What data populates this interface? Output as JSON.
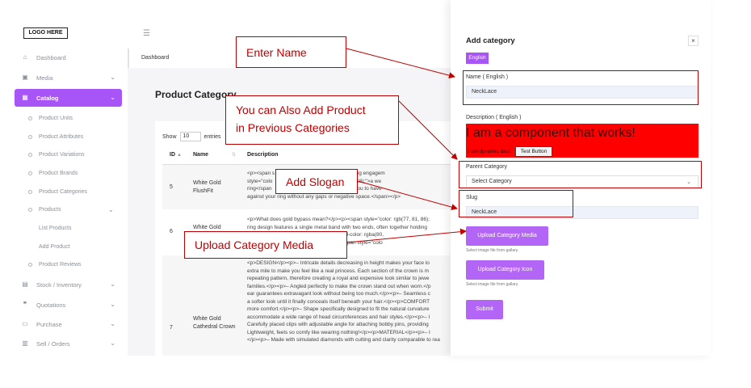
{
  "sidebar": {
    "logo": "LOGO HERE",
    "items": [
      {
        "label": "Dashboard",
        "icon": "home-icon"
      },
      {
        "label": "Media",
        "icon": "image-icon"
      },
      {
        "label": "Catalog",
        "icon": "boxes-icon"
      },
      {
        "label": "Stock / Inventory",
        "icon": "stack-icon"
      },
      {
        "label": "Quotations",
        "icon": "quote-icon"
      },
      {
        "label": "Purchase",
        "icon": "card-icon"
      },
      {
        "label": "Sell / Orders",
        "icon": "clipboard-icon"
      }
    ],
    "catalog_children": [
      "Product Units",
      "Product Attributes",
      "Product Variations",
      "Product Brands",
      "Product Categories",
      "Products",
      "Product Reviews"
    ],
    "products_children": [
      "List Products",
      "Add Product"
    ]
  },
  "main": {
    "breadcrumb": "Dashboard",
    "page_title": "Product Category",
    "show_label": "Show",
    "entries_value": "10",
    "entries_label": "entries",
    "columns": [
      "ID",
      "Name",
      "Description"
    ],
    "rows": [
      {
        "id": "5",
        "name": "White Gold FlushFit",
        "desc": "<p><span s                        y cut, a flush fit setting engagem\nstyle=\"colo                        rgba(80, 151, 255, 0.18);\">a we\nring</span                         \">. A flush fit allows you to have\nagainst your ring without any gaps or negative space.</span></p>"
      },
      {
        "id": "6",
        "name": "White Gold",
        "desc": "<p>What does gold bypass mean?</p><p><span style=\"color: rgb(77, 81, 86);\nring design features a single metal band with two ends, often together holding\n                              b(4, 12, 49); background-color: rgba(80,\n                              ir individuality</span><span style=\"colo"
      },
      {
        "id": "7",
        "name": "White Gold Cathedral Crown",
        "desc": "<p>DESIGN</p><p>– Intricate details decreasing in height makes your face lo\nextra mile to make you feel like a real princess. Each section of the crown is m\nrepeating pattern, therefore creating a royal and expensive look similar to jewe\nfamilies.</p><p>– Angled perfectly to make the crown stand out when worn.</p\near guarantees extravagant look without being too much.</p><p>– Seamless c\na softer look until it finally conceals itself beneath your hair.</p><p>COMFORT\nmore comfort.</p><p>– Shape specifically designed to fit the natural curvature\naccommodate a wide range of head circumferences and hair styles.</p><p>– I\nCarefully placed clips with adjustable angle for attaching bobby pins, providing\nLightweight, feels so comfy like wearing nothing!</p><p>MATERIAL</p><p>– I\n</p><p>– Made with simulated diamonds with cutting and clarity comparable to rea"
      }
    ]
  },
  "panel": {
    "title": "Add category",
    "close": "×",
    "lang_tab": "English",
    "name_label": "Name ( English )",
    "name_value": "NeckLace",
    "desc_label": "Description ( English )",
    "desc_big_text": "I am a component that works!",
    "desc_small_text": "I am dynamic data",
    "test_button": "Test Button",
    "parent_label": "Parent Category",
    "parent_value": "Select Category",
    "slug_label": "Slug",
    "slug_value": "NeckLace",
    "upload_media": "Upload Category Media",
    "upload_icon": "Upload Category Icon",
    "hint": "Select image file from gallary.",
    "submit": "Submit"
  },
  "annotations": {
    "enter_name": "Enter Name",
    "add_product": "You can Also Add Product in Previous Categories",
    "add_product_l1": "You can Also Add Product",
    "add_product_l2": "in Previous Categories",
    "add_slogan": "Add Slogan",
    "upload_media": "Upload Category Media"
  },
  "colors": {
    "accent": "#a855f7",
    "annotation": "#c00000",
    "desc_bg": "#ff0000"
  }
}
